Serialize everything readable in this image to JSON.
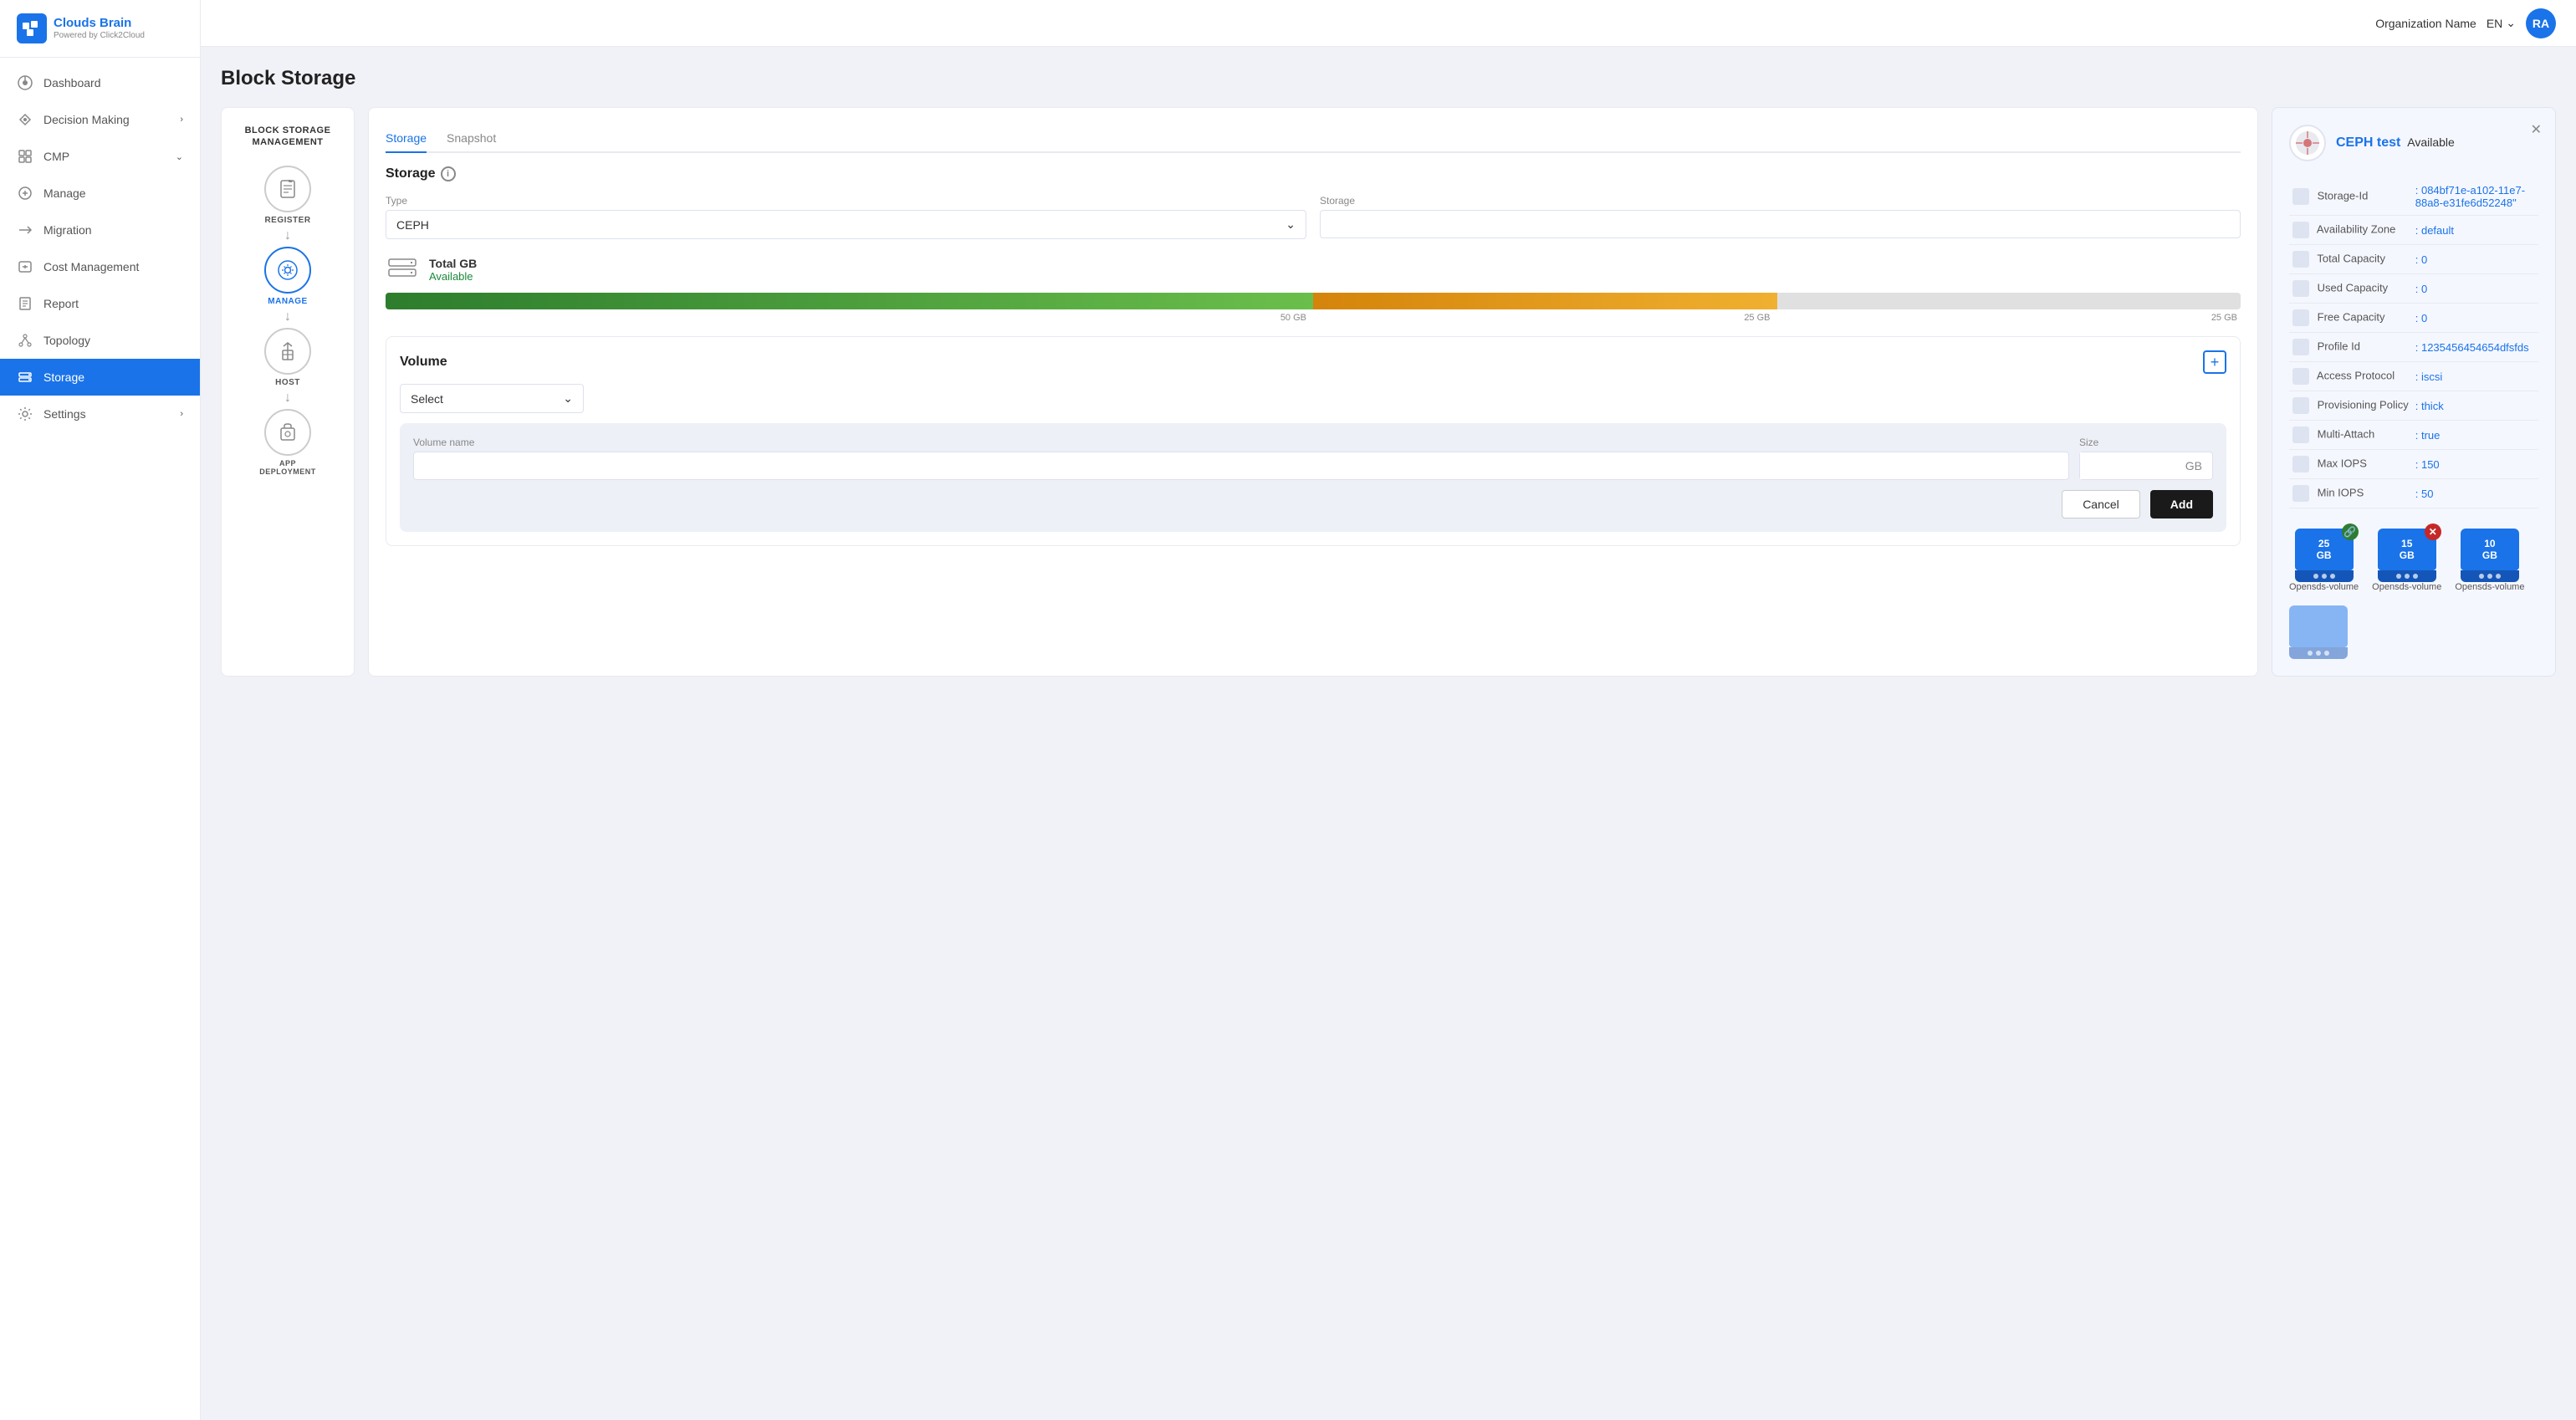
{
  "app": {
    "logo": {
      "brand": "Clouds Brain",
      "sub": "Powered by Click2Cloud",
      "initials": "CB"
    },
    "topbar": {
      "org_name": "Organization Name",
      "lang": "EN",
      "avatar": "RA"
    }
  },
  "sidebar": {
    "items": [
      {
        "id": "dashboard",
        "label": "Dashboard",
        "icon": "dashboard-icon",
        "active": false,
        "chevron": false
      },
      {
        "id": "decision-making",
        "label": "Decision Making",
        "icon": "decision-icon",
        "active": false,
        "chevron": true
      },
      {
        "id": "cmp",
        "label": "CMP",
        "icon": "cmp-icon",
        "active": false,
        "chevron": true
      },
      {
        "id": "manage",
        "label": "Manage",
        "icon": "manage-icon",
        "active": false,
        "chevron": false
      },
      {
        "id": "migration",
        "label": "Migration",
        "icon": "migration-icon",
        "active": false,
        "chevron": false
      },
      {
        "id": "cost-management",
        "label": "Cost Management",
        "icon": "cost-icon",
        "active": false,
        "chevron": false
      },
      {
        "id": "report",
        "label": "Report",
        "icon": "report-icon",
        "active": false,
        "chevron": false
      },
      {
        "id": "topology",
        "label": "Topology",
        "icon": "topology-icon",
        "active": false,
        "chevron": false
      },
      {
        "id": "storage",
        "label": "Storage",
        "icon": "storage-icon",
        "active": true,
        "chevron": false
      },
      {
        "id": "settings",
        "label": "Settings",
        "icon": "settings-icon",
        "active": false,
        "chevron": true
      }
    ]
  },
  "page": {
    "title": "Block Storage",
    "bsm": {
      "title": "BLOCK STORAGE\nMANAGEMENT",
      "steps": [
        {
          "id": "register",
          "label": "REGISTER",
          "active": false
        },
        {
          "id": "manage",
          "label": "MANAGE",
          "active": true
        },
        {
          "id": "host",
          "label": "HOST",
          "active": false
        },
        {
          "id": "app-deployment",
          "label": "APP DEPLOYMENT",
          "active": false
        }
      ]
    },
    "tabs": [
      {
        "id": "storage",
        "label": "Storage",
        "active": true
      },
      {
        "id": "snapshot",
        "label": "Snapshot",
        "active": false
      }
    ],
    "storage": {
      "section_title": "Storage",
      "type_label": "Type",
      "storage_label": "Storage",
      "type_value": "CEPH",
      "total_gb_label": "Total GB",
      "available_label": "Available",
      "bar": {
        "segment1_label": "50 GB",
        "segment2_label": "25 GB",
        "segment3_label": "25 GB"
      }
    },
    "volume": {
      "section_title": "Volume",
      "volume_name_label": "Volume name",
      "select_placeholder": "Select",
      "add_form": {
        "volume_name_label": "Volume name",
        "size_label": "Size",
        "size_unit": "GB",
        "cancel_btn": "Cancel",
        "add_btn": "Add"
      }
    },
    "detail_panel": {
      "ceph_name": "CEPH test",
      "status": "Available",
      "fields": [
        {
          "icon": "storage-id-icon",
          "key": "Storage-Id",
          "value": ": 084bf71e-a102-11e7-88a8-e31fe6d52248\""
        },
        {
          "icon": "availability-icon",
          "key": "Availability Zone",
          "value": ": default"
        },
        {
          "icon": "capacity-icon",
          "key": "Total Capacity",
          "value": ": 0"
        },
        {
          "icon": "used-icon",
          "key": "Used Capacity",
          "value": ": 0"
        },
        {
          "icon": "free-icon",
          "key": "Free Capacity",
          "value": ": 0"
        },
        {
          "icon": "profile-icon",
          "key": "Profile Id",
          "value": ": 1235456454654dfsfds"
        },
        {
          "icon": "access-icon",
          "key": "Access Protocol",
          "value": ": iscsi"
        },
        {
          "icon": "provisioning-icon",
          "key": "Provisioning Policy",
          "value": ": thick"
        },
        {
          "icon": "multiattach-icon",
          "key": "Multi-Attach",
          "value": ": true"
        },
        {
          "icon": "maxiops-icon",
          "key": "Max IOPS",
          "value": ": 150"
        },
        {
          "icon": "miniops-icon",
          "key": "Min IOPS",
          "value": ": 50"
        }
      ],
      "volumes": [
        {
          "id": "vol1",
          "size": "25 GB",
          "label": "Opensds-volume",
          "badge": "link",
          "badge_type": "green"
        },
        {
          "id": "vol2",
          "size": "15 GB",
          "label": "Opensds-volume",
          "badge": "x",
          "badge_type": "red"
        },
        {
          "id": "vol3",
          "size": "10 GB",
          "label": "Opensds-volume",
          "badge": "",
          "badge_type": ""
        },
        {
          "id": "vol4",
          "size": "",
          "label": "",
          "badge": "",
          "badge_type": ""
        }
      ]
    }
  }
}
